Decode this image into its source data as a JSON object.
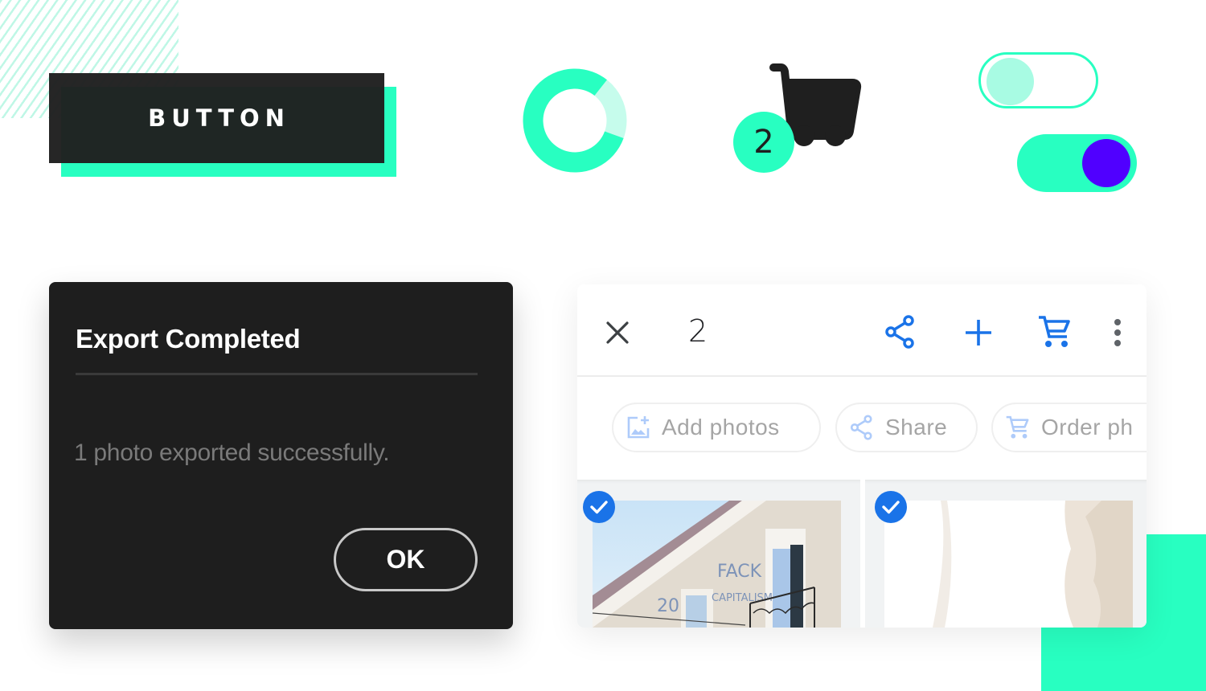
{
  "decor": {
    "accent_color": "#28ffc1",
    "accent_light": "#c6fcec",
    "dark_color": "#1f1f1f",
    "toggle_knob_on_color": "#5000ff"
  },
  "hero_button": {
    "label": "BUTTON"
  },
  "progress_ring": {
    "progress_percent": 80
  },
  "cart_widget": {
    "icon": "shopping-cart-icon",
    "badge_count": "2"
  },
  "toggles": [
    {
      "name": "toggle-off",
      "state": "off"
    },
    {
      "name": "toggle-on",
      "state": "on"
    }
  ],
  "export_dialog": {
    "title": "Export Completed",
    "message": "1 photo exported successfully.",
    "ok_label": "OK"
  },
  "photos_panel": {
    "selection_count": "2",
    "topbar_icons": {
      "close": "close-icon",
      "share": "share-icon",
      "add": "plus-icon",
      "order": "shopping-cart-icon",
      "more": "more-vert-icon"
    },
    "action_chips": [
      {
        "icon": "add-photo-icon",
        "label": "Add photos"
      },
      {
        "icon": "share-icon",
        "label": "Share"
      },
      {
        "icon": "shopping-cart-icon",
        "label": "Order photos"
      }
    ],
    "action_chips_visible": [
      "Add photos",
      "Share",
      "Order ph"
    ],
    "photos": [
      {
        "description": "Building facade with balcony and graffiti",
        "selected": true
      },
      {
        "description": "Bright white wall texture",
        "selected": true
      }
    ],
    "accent_color": "#1a73e8"
  }
}
